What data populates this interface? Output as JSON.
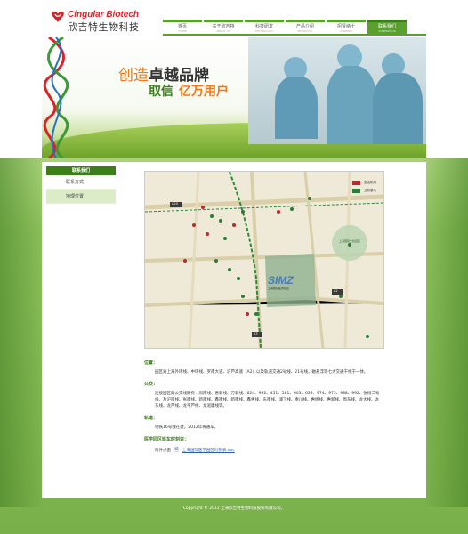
{
  "brand": {
    "name_en": "Cingular Biotech",
    "name_cn": "欣吉特生物科技",
    "color": "#d8232a"
  },
  "nav": {
    "items": [
      {
        "label": "首页",
        "sub": "HOME"
      },
      {
        "label": "关于欣吉特",
        "sub": "ABOUT US"
      },
      {
        "label": "科技研发",
        "sub": "TECHNOLOGY"
      },
      {
        "label": "产品介绍",
        "sub": "PRODUCTS"
      },
      {
        "label": "招贤纳士",
        "sub": "CAREERS"
      },
      {
        "label": "联系我们",
        "sub": "CONTACT US"
      }
    ],
    "active_index": 5
  },
  "banner": {
    "slogan_line1_a": "创造",
    "slogan_line1_b": "卓越品牌",
    "slogan_line2_a": "取信",
    "slogan_line2_b": "亿万用户"
  },
  "sidebar": {
    "title": "联系我们",
    "items": [
      {
        "label": "联系方式"
      },
      {
        "label": "地理位置"
      }
    ],
    "active_index": 1
  },
  "map": {
    "legend": [
      {
        "label": "生活机构",
        "color": "#c0272d"
      },
      {
        "label": "业务基地",
        "color": "#2d7a3a"
      }
    ],
    "center_label_en": "SIMZ",
    "center_label_cn": "上海国际医学园区",
    "road_labels": [
      "A20",
      "A2",
      "A3"
    ],
    "park_label": "上海国际文化园区"
  },
  "sections": [
    {
      "title": "位置：",
      "text": "园区离上海外环线、中环线、罗南大道、沪芦高速（A2）以及轨道交通2号线、21号线，磁悬浮等七大交通干线于一体。"
    },
    {
      "title": "公交：",
      "text": "连接园区的公交线路有：周南线、惠新线、万新线、624、992、451、581、603、639、974、975、988、992、张杨二号线、及沪南线、张南线、新南线、鑫南线、新南线、鑫惠线、东南线、浦卫线、奉川线、惠杨线、惠新线、周东线、龙大线、龙东线、龙芦线、龙平芦线、龙泥康线等。"
    },
    {
      "title": "轨道：",
      "text": "地铁16号线在建，2012年将通车。"
    },
    {
      "title": "医学园区班车时刻表：",
      "text": ""
    }
  ],
  "attachment": {
    "prefix": "附件点击",
    "link": "上海国际医学园区时刻表.doc"
  },
  "footer": {
    "text": "Copyright © 2012 上海欣吉特生物科技股份有限公司。"
  },
  "colors": {
    "primary_green": "#5aa02c",
    "dark_green": "#3c7f1a",
    "accent_orange": "#ef7a16"
  }
}
